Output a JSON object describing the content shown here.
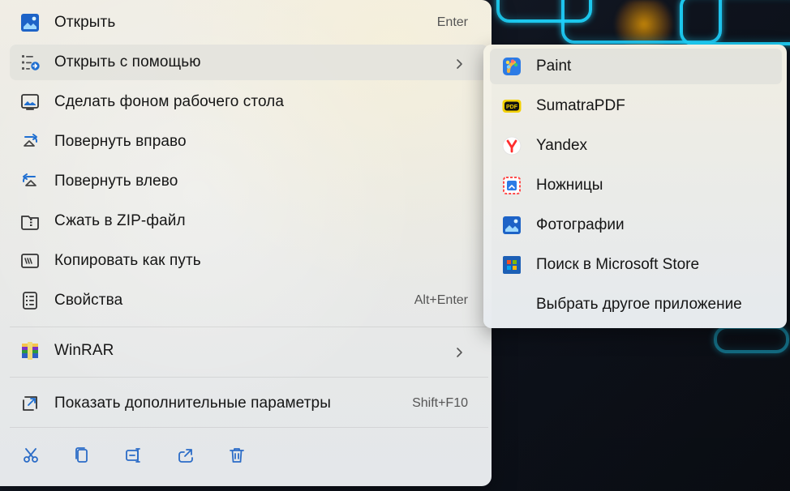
{
  "window": {
    "title": ""
  },
  "menu": {
    "items": [
      {
        "label": "Открыть",
        "shortcut": "Enter",
        "icon": "photo-icon"
      },
      {
        "label": "Открыть с помощью",
        "icon": "open-with-icon",
        "has_submenu": true,
        "active": true
      },
      {
        "label": "Сделать фоном рабочего стола",
        "icon": "desktop-background-icon"
      },
      {
        "label": "Повернуть вправо",
        "icon": "rotate-right-icon"
      },
      {
        "label": "Повернуть влево",
        "icon": "rotate-left-icon"
      },
      {
        "label": "Сжать в ZIP-файл",
        "icon": "zip-folder-icon"
      },
      {
        "label": "Копировать как путь",
        "icon": "copy-path-icon"
      },
      {
        "label": "Свойства",
        "shortcut": "Alt+Enter",
        "icon": "properties-icon"
      },
      {
        "label": "WinRAR",
        "icon": "winrar-icon",
        "has_submenu": true
      },
      {
        "label": "Показать дополнительные параметры",
        "shortcut": "Shift+F10",
        "icon": "more-options-icon"
      }
    ],
    "toolbar": [
      {
        "name": "cut",
        "icon": "scissors-icon"
      },
      {
        "name": "copy",
        "icon": "copy-icon"
      },
      {
        "name": "rename",
        "icon": "rename-icon"
      },
      {
        "name": "share",
        "icon": "share-icon"
      },
      {
        "name": "delete",
        "icon": "trash-icon"
      }
    ]
  },
  "submenu": {
    "items": [
      {
        "label": "Paint",
        "icon": "paint-icon",
        "active": true
      },
      {
        "label": "SumatraPDF",
        "icon": "sumatra-pdf-icon"
      },
      {
        "label": "Yandex",
        "icon": "yandex-icon"
      },
      {
        "label": "Ножницы",
        "icon": "snipping-tool-icon"
      },
      {
        "label": "Фотографии",
        "icon": "photos-icon"
      },
      {
        "label": "Поиск в Microsoft Store",
        "icon": "microsoft-store-icon"
      },
      {
        "label": "Выбрать другое приложение",
        "icon": ""
      }
    ]
  },
  "colors": {
    "accent": "#1f6fd1",
    "neon": "#1ed7ff",
    "text": "#161616",
    "muted": "#555555"
  }
}
